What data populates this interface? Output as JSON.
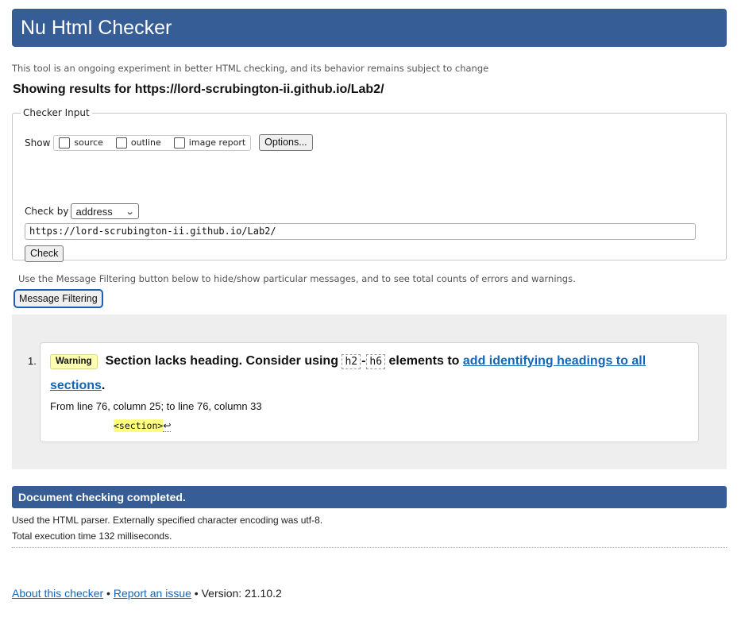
{
  "header": {
    "title": "Nu Html Checker"
  },
  "intro": "This tool is an ongoing experiment in better HTML checking, and its behavior remains subject to change",
  "results_for": "Showing results for https://lord-scrubington-ii.github.io/Lab2/",
  "checker_input": {
    "legend": "Checker Input",
    "show_label": "Show",
    "options": [
      {
        "label": "source",
        "checked": false
      },
      {
        "label": "outline",
        "checked": false
      },
      {
        "label": "image report",
        "checked": false
      }
    ],
    "options_button": "Options...",
    "check_by_label": "Check by",
    "check_by_value": "address",
    "url_value": "https://lord-scrubington-ii.github.io/Lab2/",
    "check_button": "Check"
  },
  "filter": {
    "note": "Use the Message Filtering button below to hide/show particular messages, and to see total counts of errors and warnings.",
    "button": "Message Filtering"
  },
  "messages": [
    {
      "number": "1.",
      "type": "Warning",
      "text_before": "Section lacks heading. Consider using",
      "code_1": "h2",
      "dash": "-",
      "code_2": "h6",
      "text_middle": "elements to",
      "link_text": "add identifying headings to all sections",
      "text_after": ".",
      "location": "From line 76, column 25; to line 76, column 33",
      "extract": "<section>",
      "return_symbol": "↩"
    }
  ],
  "completion": {
    "title": "Document checking completed.",
    "parser_info": "Used the HTML parser. Externally specified character encoding was utf-8.",
    "time_info": "Total execution time 132 milliseconds."
  },
  "footer": {
    "about_link": "About this checker",
    "separator_1": " • ",
    "report_link": "Report an issue",
    "version_text": " • Version: 21.10.2"
  },
  "colors": {
    "header_bg": "#365d95",
    "warning_badge": "#ffffb0",
    "link": "#1467b8",
    "message_area_bg": "#eeeeee"
  }
}
